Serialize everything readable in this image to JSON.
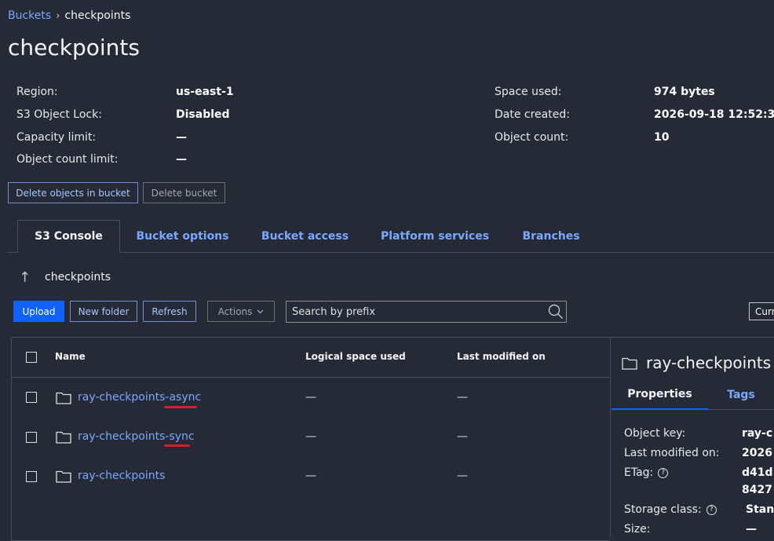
{
  "breadcrumb": {
    "root": "Buckets",
    "current": "checkpoints"
  },
  "page_title": "checkpoints",
  "info": {
    "left": [
      {
        "label": "Region:",
        "value": "us-east-1"
      },
      {
        "label": "S3 Object Lock:",
        "value": "Disabled"
      },
      {
        "label": "Capacity limit:",
        "value": "—"
      },
      {
        "label": "Object count limit:",
        "value": "—"
      }
    ],
    "right": [
      {
        "label": "Space used:",
        "value": "974 bytes"
      },
      {
        "label": "Date created:",
        "value": "2026-09-18 12:52:3"
      },
      {
        "label": "Object count:",
        "value": "10"
      }
    ]
  },
  "bucket_actions": {
    "delete_objects": "Delete objects in bucket",
    "delete_bucket": "Delete bucket"
  },
  "tabs": [
    "S3 Console",
    "Bucket options",
    "Bucket access",
    "Platform services",
    "Branches"
  ],
  "path": {
    "current": "checkpoints"
  },
  "toolbar": {
    "upload": "Upload",
    "new_folder": "New folder",
    "refresh": "Refresh",
    "actions": "Actions",
    "search_placeholder": "Search by prefix",
    "current_cut": "Curr"
  },
  "table": {
    "columns": [
      "Name",
      "Logical space used",
      "Last modified on"
    ],
    "rows": [
      {
        "name": "ray-checkpoints-async",
        "space": "—",
        "modified": "—"
      },
      {
        "name": "ray-checkpoints-sync",
        "space": "—",
        "modified": "—"
      },
      {
        "name": "ray-checkpoints",
        "space": "—",
        "modified": "—"
      }
    ]
  },
  "panel": {
    "title": "ray-checkpoints",
    "tabs": [
      "Properties",
      "Tags"
    ],
    "props": [
      {
        "label": "Object key:",
        "value": "ray-c"
      },
      {
        "label": "Last modified on:",
        "value": "2026"
      },
      {
        "label": "ETag:",
        "value": "d41d",
        "value2": "8427"
      },
      {
        "label": "Storage class:",
        "value": "Stan"
      },
      {
        "label": "Size:",
        "value": "—"
      }
    ]
  },
  "colors": {
    "background": "#262a36",
    "link": "#78a9ff",
    "primary": "#0f62fe",
    "highlight": "#da1e28"
  }
}
